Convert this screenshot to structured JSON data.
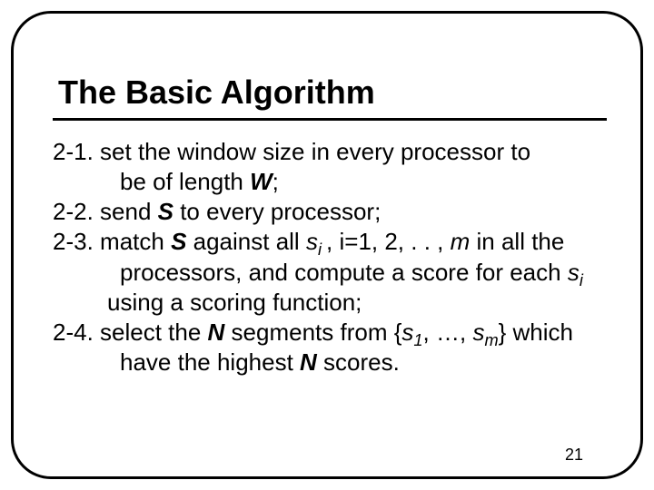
{
  "title": "The Basic Algorithm",
  "steps": {
    "s1": {
      "num": "2-1.",
      "a": " set the window size in every processor to",
      "b": "be of length ",
      "w": "W",
      "c": ";"
    },
    "s2": {
      "num": "2-2.",
      "a": " send ",
      "s": "S",
      "b": " to every processor;"
    },
    "s3": {
      "num": "2-3.",
      "a": " match ",
      "s": "S",
      "b": " against all ",
      "si": "s",
      "si_sub": "i ",
      "c": ", i=1, 2, . . , ",
      "m": "m",
      "d": " in all the",
      "line2a": "processors, and compute a score for each ",
      "line2b": "s",
      "line2b_sub": "i",
      "line3": "using a scoring function;"
    },
    "s4": {
      "num": "2-4.",
      "a": " select the ",
      "n1": "N",
      "b": " segments from {",
      "s1": "s",
      "s1_sub": "1",
      "c": ", …, ",
      "sm": "s",
      "sm_sub": "m",
      "d": "} which",
      "line2a": "have the highest ",
      "n2": "N",
      "line2b": " scores."
    }
  },
  "page_number": "21"
}
